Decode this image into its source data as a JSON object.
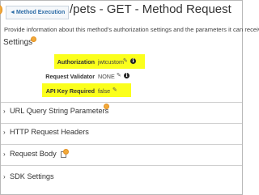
{
  "header": {
    "back_label": "Method Execution",
    "title": "/pets - GET - Method Request"
  },
  "description": "Provide information about this method's authorization settings and the parameters it can receive.",
  "settings": {
    "heading": "Settings",
    "rows": [
      {
        "label": "Authorization",
        "value": "jwtcustom"
      },
      {
        "label": "Request Validator",
        "value": "NONE"
      },
      {
        "label": "API Key Required",
        "value": "false"
      }
    ]
  },
  "sections": [
    {
      "label": "URL Query String Parameters"
    },
    {
      "label": "HTTP Request Headers"
    },
    {
      "label": "Request Body"
    },
    {
      "label": "SDK Settings"
    }
  ],
  "colors": {
    "highlight": "#fbff1c",
    "marker": "#f2a93a",
    "link": "#2f6ea8"
  },
  "icons": [
    "back-arrow-icon",
    "pencil-icon",
    "info-icon",
    "chevron-right-icon",
    "document-icon"
  ]
}
